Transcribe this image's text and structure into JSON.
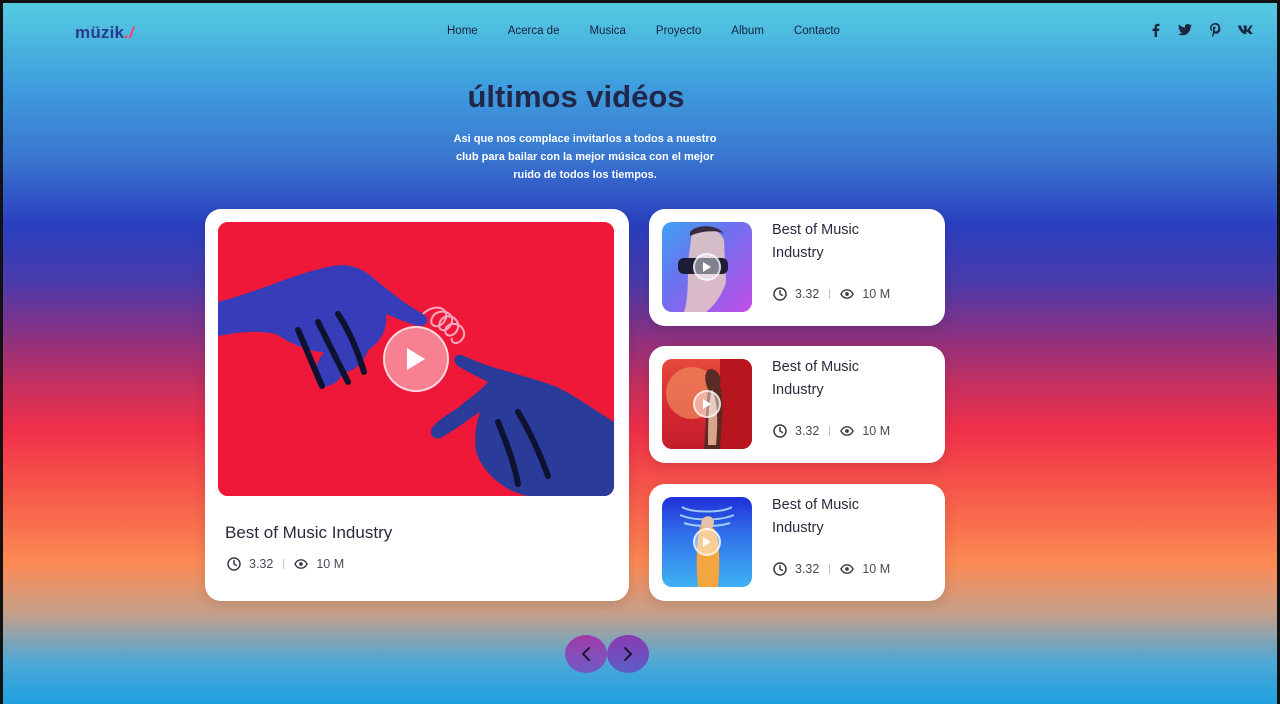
{
  "header": {
    "logo": "müzik",
    "logo_mark": "./",
    "nav": [
      {
        "label": "Home"
      },
      {
        "label": "Acerca de"
      },
      {
        "label": "Musica"
      },
      {
        "label": "Proyecto"
      },
      {
        "label": "Album"
      },
      {
        "label": "Contacto"
      }
    ],
    "social_icons": [
      "facebook-icon",
      "twitter-icon",
      "pinterest-icon",
      "vk-icon"
    ]
  },
  "section": {
    "title": "últimos vidéos",
    "subtitle": "Asi que nos complace invitarlos a todos a nuestro club para bailar con la mejor música con el mejor ruido de todos los tiempos."
  },
  "featured": {
    "title": "Best of Music Industry",
    "duration": "3.32",
    "views": "10 M"
  },
  "videos": [
    {
      "title": "Best of Music Industry",
      "duration": "3.32",
      "views": "10 M"
    },
    {
      "title": "Best of Music Industry",
      "duration": "3.32",
      "views": "10 M"
    },
    {
      "title": "Best of Music Industry",
      "duration": "3.32",
      "views": "10 M"
    }
  ],
  "colors": {
    "accent": "#2b3a8f",
    "brand_pink": "#ff3c6a",
    "heading": "#22274a",
    "thumb_red": "#f01838"
  }
}
